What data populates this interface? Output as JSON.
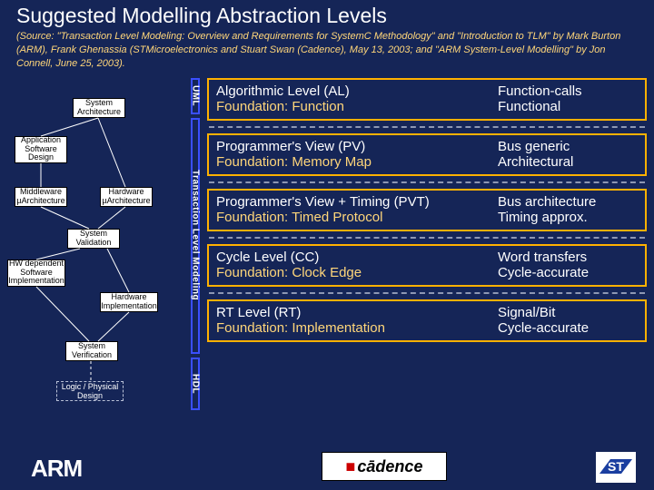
{
  "title": "Suggested Modelling Abstraction Levels",
  "source": "(Source: \"Transaction Level Modeling: Overview and Requirements for SystemC Methodology\" and \"Introduction to TLM\" by Mark Burton (ARM), Frank Ghenassia (STMicroelectronics and Stuart Swan (Cadence), May 13, 2003; and \"ARM System-Level Modelling\" by Jon Connell, June 25, 2003).",
  "flow": {
    "sys_arch": "System\nArchitecture",
    "app_sw": "Application\nSoftware\nDesign",
    "middleware": "Middleware\nµArchitecture",
    "hw_uarch": "Hardware\nµArchitecture",
    "sys_val": "System\nValidation",
    "hw_dep_sw": "HW dependent\nSoftware\nImplementation",
    "hw_impl": "Hardware\nImplementation",
    "sys_verif": "System\nVerification",
    "logic_phys": "Logic / Physical\nDesign"
  },
  "vbar": {
    "uml": "UML",
    "tlm": "Transaction Level Modeling",
    "hdl": "HDL"
  },
  "levels": [
    {
      "name": "Algorithmic Level (AL)",
      "style": "Function-calls",
      "foundation": "Foundation: Function",
      "acc": "Functional"
    },
    {
      "name": "Programmer's View (PV)",
      "style": "Bus generic",
      "foundation": "Foundation: Memory Map",
      "acc": "Architectural"
    },
    {
      "name": "Programmer's View + Timing (PVT)",
      "style": "Bus architecture",
      "foundation": "Foundation: Timed Protocol",
      "acc": "Timing approx."
    },
    {
      "name": "Cycle Level (CC)",
      "style": "Word transfers",
      "foundation": "Foundation: Clock Edge",
      "acc": "Cycle-accurate"
    },
    {
      "name": "RT Level (RT)",
      "style": "Signal/Bit",
      "foundation": "Foundation: Implementation",
      "acc": "Cycle-accurate"
    }
  ],
  "logos": {
    "arm": "ARM",
    "cadence": "cādence",
    "st": "ST"
  }
}
